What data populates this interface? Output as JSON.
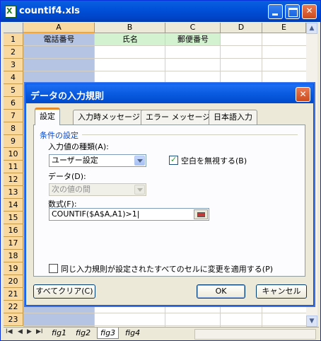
{
  "window": {
    "title": "countif4.xls"
  },
  "sheet": {
    "columns": [
      "A",
      "B",
      "C",
      "D",
      "E"
    ],
    "rows": [
      "1",
      "2",
      "3",
      "4",
      "5",
      "6",
      "7",
      "8",
      "9",
      "10",
      "11",
      "12",
      "13",
      "14",
      "15",
      "16",
      "17",
      "18",
      "19",
      "20",
      "21",
      "22",
      "23"
    ],
    "headers": {
      "a1": "電話番号",
      "b1": "氏名",
      "c1": "郵便番号"
    },
    "tabs": [
      "fig1",
      "fig2",
      "fig3",
      "fig4"
    ],
    "active_tab": "fig3"
  },
  "dialog": {
    "title": "データの入力規則",
    "tabs": [
      "設定",
      "入力時メッセージ",
      "エラー メッセージ",
      "日本語入力"
    ],
    "group_label": "条件の設定",
    "allow_label": "入力値の種類(A):",
    "allow_value": "ユーザー設定",
    "ignore_blank_label": "空白を無視する(B)",
    "ignore_blank_checked": true,
    "data_label": "データ(D):",
    "data_value": "次の値の間",
    "formula_label": "数式(F):",
    "formula_value": "COUNTIF($A$A,A1)>1|",
    "apply_all_label": "同じ入力規則が設定されたすべてのセルに変更を適用する(P)",
    "apply_all_checked": false,
    "clear_all_button": "すべてクリア(C)",
    "ok_button": "OK",
    "cancel_button": "キャンセル"
  }
}
